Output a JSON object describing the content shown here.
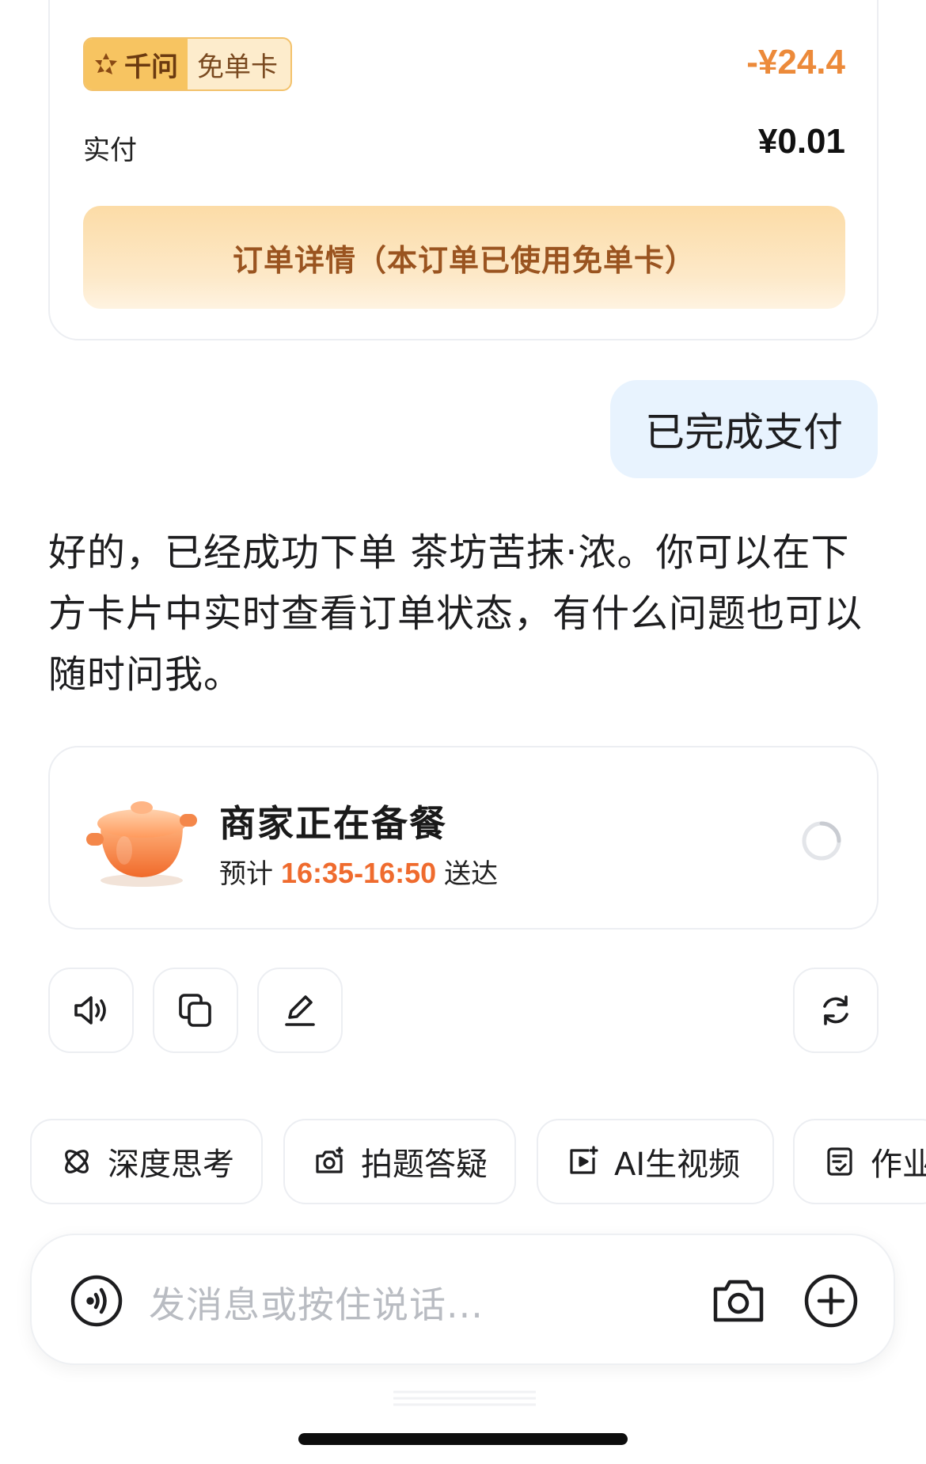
{
  "order_card": {
    "coupon_brand": "千问",
    "coupon_name": "免单卡",
    "discount": "-¥24.4",
    "paid_label": "实付",
    "paid_value": "¥0.01",
    "detail_button": "订单详情（本订单已使用免单卡）"
  },
  "user_message": "已完成支付",
  "assistant_reply": "好的，已经成功下单 茶坊苦抹·浓。你可以在下方卡片中实时查看订单状态，有什么问题也可以随时问我。",
  "status_card": {
    "title": "商家正在备餐",
    "eta_prefix": "预计",
    "eta_time": "16:35-16:50",
    "eta_suffix": "送达"
  },
  "actions": [
    "speaker-icon",
    "copy-icon",
    "edit-icon",
    "regenerate-icon"
  ],
  "chips": [
    {
      "label": "深度思考",
      "icon": "deep-think-icon"
    },
    {
      "label": "拍题答疑",
      "icon": "photo-question-icon"
    },
    {
      "label": "AI生视频",
      "icon": "ai-video-icon"
    },
    {
      "label": "作业",
      "icon": "homework-icon"
    }
  ],
  "input": {
    "placeholder": "发消息或按住说话..."
  },
  "colors": {
    "accent_orange": "#ef6b2e",
    "discount_orange": "#ec8a3a",
    "bubble_blue": "#e8f3fe",
    "coupon_gold": "#f7c461"
  }
}
